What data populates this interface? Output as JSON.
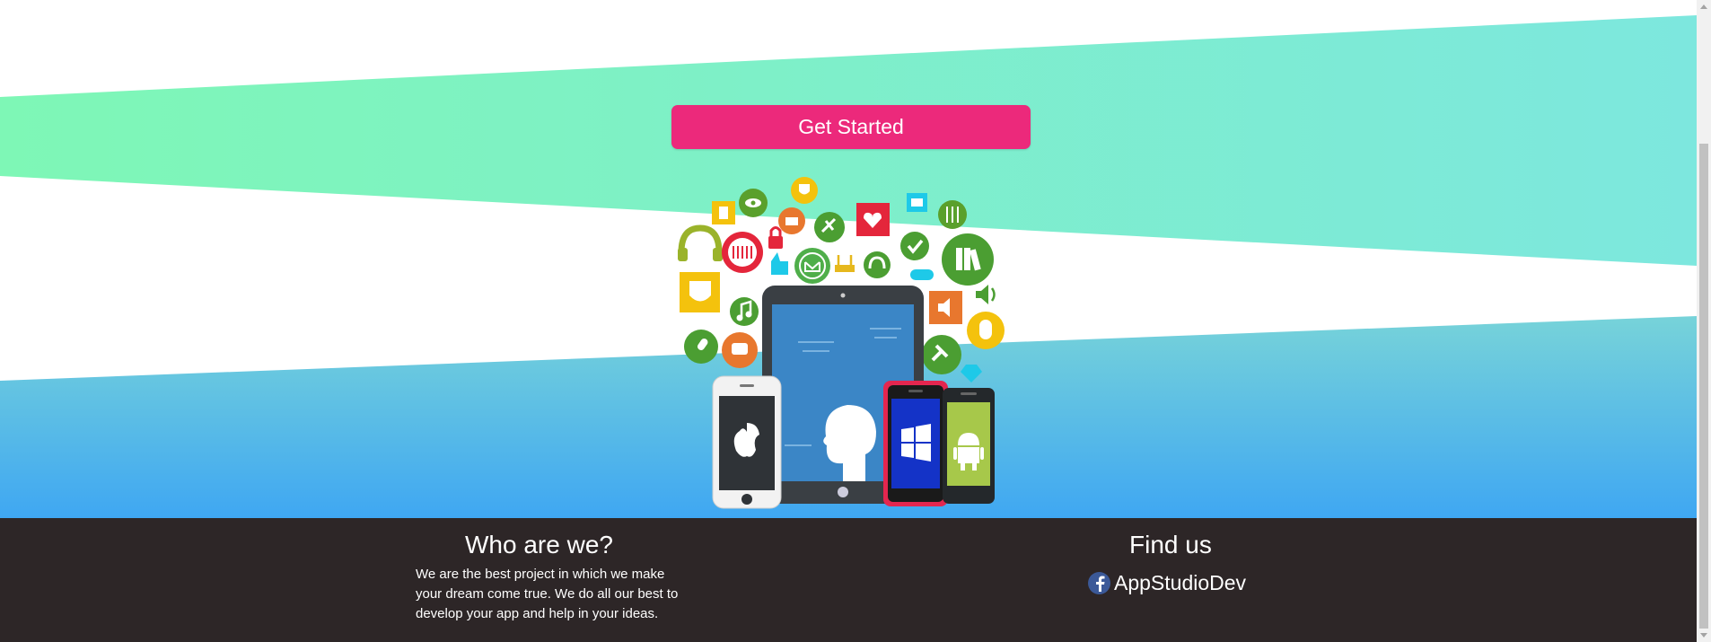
{
  "hero": {
    "cta_label": "Get Started",
    "colors": {
      "band_top_left": "#7ef7b6",
      "band_top_right": "#7de7de",
      "band_bottom_top": "#77d3d9",
      "band_bottom_bottom": "#3fa7f2",
      "cta": "#ec297b"
    }
  },
  "illustration": {
    "icons": [
      "calculator-icon",
      "eye-icon",
      "shield-icon",
      "camera-icon",
      "satellite-icon",
      "heart-icon",
      "id-card-icon",
      "sliders-icon",
      "headphones-icon",
      "equalizer-icon",
      "lock-icon",
      "thumbs-up-icon",
      "mail-icon",
      "router-icon",
      "headset-icon",
      "check-icon",
      "gamepad-icon",
      "books-icon",
      "speaker-icon",
      "volume-icon",
      "music-note-icon",
      "microphone-icon",
      "chat-icon",
      "pin-icon",
      "mouse-icon",
      "diamond-icon"
    ],
    "devices": [
      "tablet",
      "iphone",
      "windows-phone",
      "android-phone"
    ]
  },
  "footer": {
    "who_title": "Who are we?",
    "who_text": "We are the best project in which we make your dream come true. We do all our best to develop your app and help in your ideas.",
    "find_title": "Find us",
    "facebook_label": "AppStudioDev",
    "background": "#2d2627"
  }
}
